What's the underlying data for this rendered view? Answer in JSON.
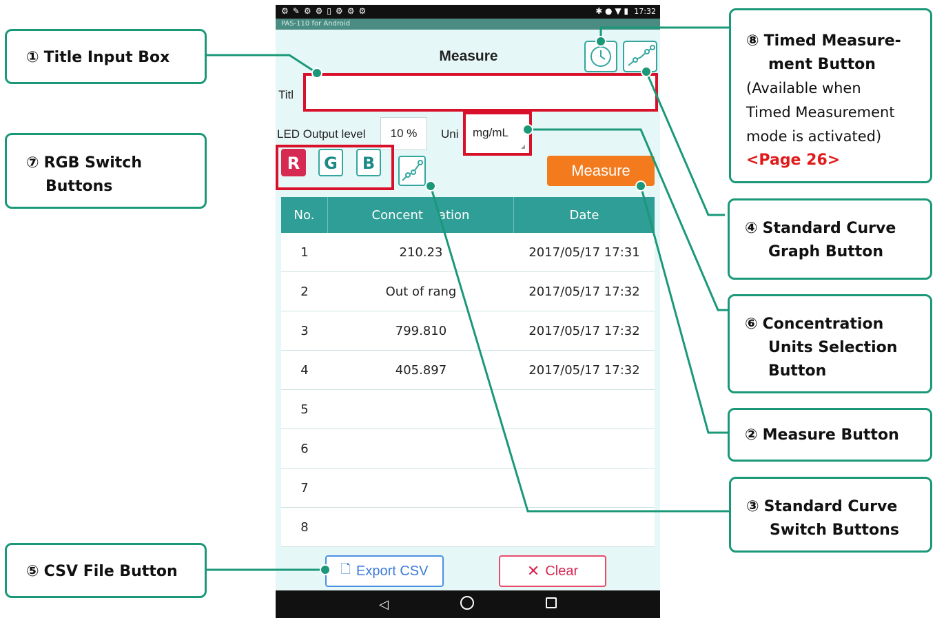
{
  "status_bar": {
    "time": "17:32"
  },
  "app_label": "PAS-110 for Android",
  "screen": {
    "title": "Measure",
    "title_label": "Titl",
    "led_label": "LED Output level",
    "led_value": "10 %",
    "unit_label": "Uni",
    "unit_value": "mg/mL",
    "rgb_buttons": [
      "R",
      "G",
      "B"
    ],
    "rgb_active": "R",
    "measure_label": "Measure",
    "table": {
      "headers": [
        "No.",
        "Concent",
        "ation",
        "Date"
      ],
      "rows": [
        {
          "no": "1",
          "conc": "210.23",
          "date": "2017/05/17 17:31"
        },
        {
          "no": "2",
          "conc": "Out of rang",
          "date": "2017/05/17 17:32"
        },
        {
          "no": "3",
          "conc": "799.810",
          "date": "2017/05/17 17:32"
        },
        {
          "no": "4",
          "conc": "405.897",
          "date": "2017/05/17 17:32"
        },
        {
          "no": "5",
          "conc": "",
          "date": ""
        },
        {
          "no": "6",
          "conc": "",
          "date": ""
        },
        {
          "no": "7",
          "conc": "",
          "date": ""
        },
        {
          "no": "8",
          "conc": "",
          "date": ""
        }
      ]
    },
    "export_label": "Export CSV",
    "clear_label": "Clear"
  },
  "callouts": {
    "c1": {
      "num": "①",
      "text": "Title Input Box"
    },
    "c7": {
      "num": "⑦",
      "line1": "RGB Switch",
      "line2": "Buttons"
    },
    "c5": {
      "num": "⑤",
      "text": "CSV File Button"
    },
    "c8": {
      "num": "⑧",
      "line1": "Timed Measure-",
      "line2": "ment Button",
      "line3": "(Available when",
      "line4": "Timed Measurement",
      "line5": "mode is activated)",
      "link": "<Page 26>"
    },
    "c4": {
      "num": "④",
      "line1": "Standard Curve",
      "line2": "Graph Button"
    },
    "c6": {
      "num": "⑥",
      "line1": "Concentration",
      "line2": "Units Selection",
      "line3": "Button"
    },
    "c2": {
      "num": "②",
      "text": "Measure Button"
    },
    "c3": {
      "num": "③",
      "line1": "Standard Curve",
      "line2": "Switch Buttons"
    }
  },
  "colors": {
    "callout_border": "#1a9878",
    "highlight": "#d8102a",
    "table_header": "#2f9e96",
    "measure_button": "#f47a1e",
    "rgb_active": "#d62a53"
  }
}
